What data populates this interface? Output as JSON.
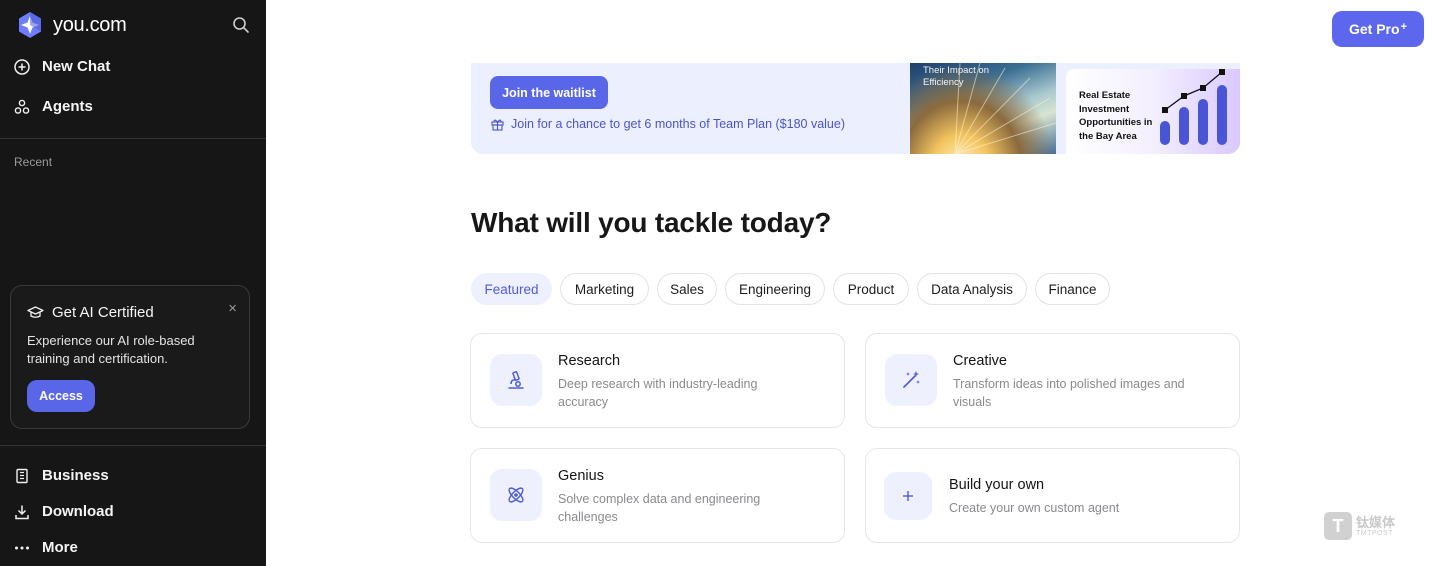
{
  "app": {
    "name": "you.com"
  },
  "sidebar": {
    "nav": [
      {
        "label": "New Chat",
        "icon": "plus-circle-icon"
      },
      {
        "label": "Agents",
        "icon": "agents-icon"
      }
    ],
    "recent_label": "Recent",
    "promo": {
      "title": "Get AI Certified",
      "description": "Experience our AI role-based training and certification.",
      "button": "Access",
      "close": "×"
    },
    "footer": [
      {
        "label": "Business",
        "icon": "building-icon"
      },
      {
        "label": "Download",
        "icon": "download-icon"
      },
      {
        "label": "More",
        "icon": "more-dots-icon"
      }
    ]
  },
  "header": {
    "get_pro_label": "Get Pro",
    "get_pro_suffix": "+"
  },
  "banner": {
    "waitlist_button": "Join the waitlist",
    "waitlist_note": "Join for a chance to get 6 months of Team Plan ($180 value)",
    "art_caption": "Their Impact on Efficiency",
    "chart_caption": "Real Estate Investment Opportunities in the Bay Area",
    "accent_color": "#5a66e8"
  },
  "main": {
    "headline": "What will you tackle today?",
    "categories": [
      "Featured",
      "Marketing",
      "Sales",
      "Engineering",
      "Product",
      "Data Analysis",
      "Finance"
    ],
    "active_category": "Featured",
    "cards": [
      {
        "title": "Research",
        "description": "Deep research with industry-leading accuracy",
        "icon": "microscope-icon"
      },
      {
        "title": "Creative",
        "description": "Transform ideas into polished images and visuals",
        "icon": "magic-wand-icon"
      },
      {
        "title": "Genius",
        "description": "Solve complex data and engineering challenges",
        "icon": "atom-icon"
      },
      {
        "title": "Build your own",
        "description": "Create your own custom agent",
        "icon": "plus-icon"
      }
    ]
  },
  "watermark": {
    "cn": "钛媒体",
    "en": "TMTPOST"
  }
}
